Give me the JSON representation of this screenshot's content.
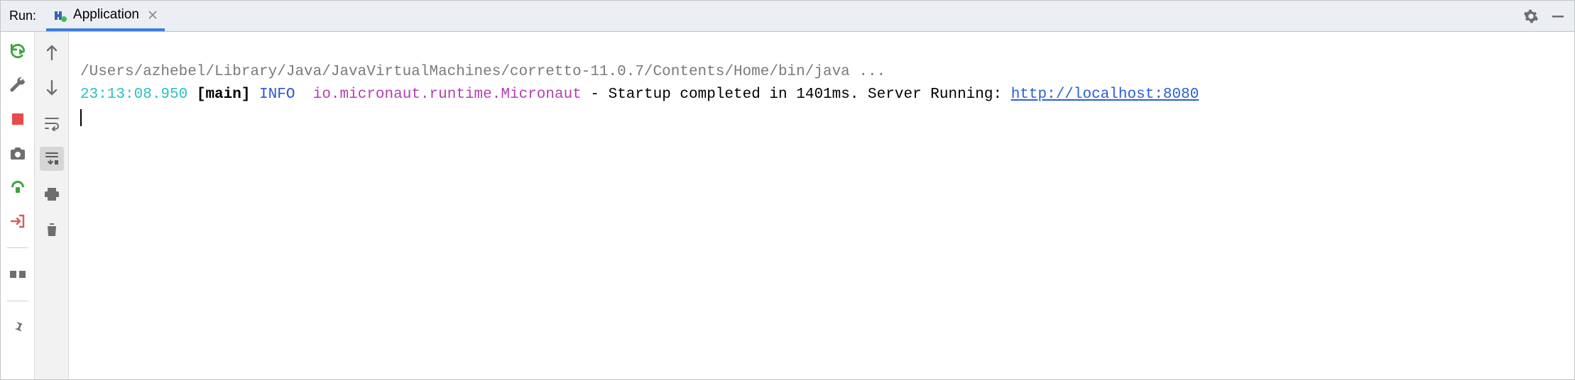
{
  "header": {
    "run_label": "Run:",
    "tab": {
      "label": "Application"
    }
  },
  "console": {
    "command": "/Users/azhebel/Library/Java/JavaVirtualMachines/corretto-11.0.7/Contents/Home/bin/java ...",
    "log": {
      "timestamp": "23:13:08.950",
      "thread": "[main]",
      "level": "INFO",
      "logger": "io.micronaut.runtime.Micronaut",
      "sep": " - ",
      "message": "Startup completed in 1401ms. Server Running: ",
      "url": "http://localhost:8080"
    }
  }
}
